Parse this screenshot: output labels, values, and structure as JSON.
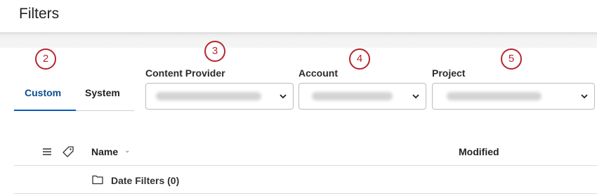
{
  "page": {
    "title": "Filters"
  },
  "callouts": [
    "2",
    "3",
    "4",
    "5"
  ],
  "tabs": [
    {
      "label": "Custom",
      "active": true
    },
    {
      "label": "System",
      "active": false
    }
  ],
  "filters": {
    "content_provider": {
      "label": "Content Provider",
      "value": "content-provider-blurred"
    },
    "account": {
      "label": "Account",
      "value": "account-blurred"
    },
    "project": {
      "label": "Project",
      "value": "project-blurred"
    }
  },
  "grid": {
    "columns": {
      "name": "Name",
      "modified": "Modified"
    },
    "rows": [
      {
        "label": "Date Filters (0)",
        "icon": "folder-icon"
      }
    ]
  },
  "colors": {
    "accent": "#0a5ab8",
    "callout": "#b5262e"
  }
}
